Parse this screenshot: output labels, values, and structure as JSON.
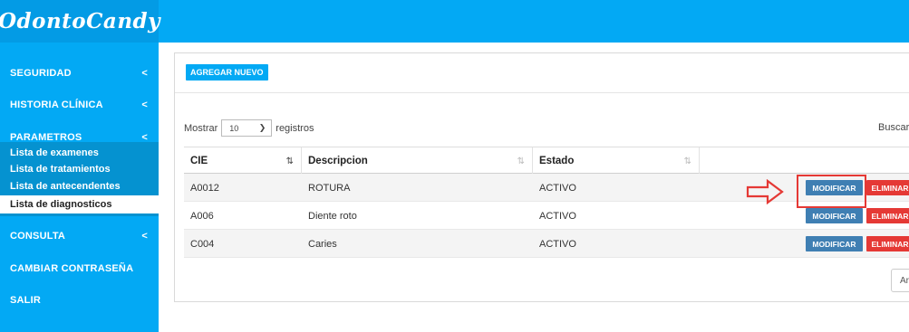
{
  "app": {
    "logo_text": "OdontoCandy"
  },
  "sidebar": {
    "items": [
      {
        "label": "SEGURIDAD",
        "chevron": "<"
      },
      {
        "label": "HISTORIA CLÍNICA",
        "chevron": "<"
      },
      {
        "label": "PARAMETROS",
        "chevron": "<"
      },
      {
        "label": "CONSULTA",
        "chevron": "<"
      },
      {
        "label": "CAMBIAR CONTRASEÑA"
      },
      {
        "label": "SALIR"
      }
    ],
    "submenu": [
      {
        "label": "Lista de examenes"
      },
      {
        "label": "Lista de tratamientos"
      },
      {
        "label": "Lista de antecendentes"
      },
      {
        "label": "Lista de diagnosticos",
        "active": true
      }
    ]
  },
  "toolbar": {
    "add_label": "AGREGAR NUEVO"
  },
  "table_controls": {
    "show_label": "Mostrar",
    "page_length": "10",
    "records_label": "registros",
    "search_label": "Buscar:"
  },
  "table": {
    "columns": [
      "CIE",
      "Descripcion",
      "Estado",
      ""
    ],
    "rows": [
      {
        "cie": "A0012",
        "descripcion": "ROTURA",
        "estado": "ACTIVO",
        "modify_label": "MODIFICAR",
        "delete_label": "ELIMINAR"
      },
      {
        "cie": "A006",
        "descripcion": "Diente roto",
        "estado": "ACTIVO",
        "modify_label": "MODIFICAR",
        "delete_label": "ELIMINAR"
      },
      {
        "cie": "C004",
        "descripcion": "Caries",
        "estado": "ACTIVO",
        "modify_label": "MODIFICAR",
        "delete_label": "ELIMINAR"
      }
    ]
  },
  "pagination": {
    "prev_label": "Ar"
  },
  "colors": {
    "brand": "#03a9f4",
    "modify": "#3f7fb3",
    "delete": "#e53935",
    "annotation": "#e53935"
  },
  "annotations": {
    "arrow_icon": "right-arrow-outline-icon"
  }
}
